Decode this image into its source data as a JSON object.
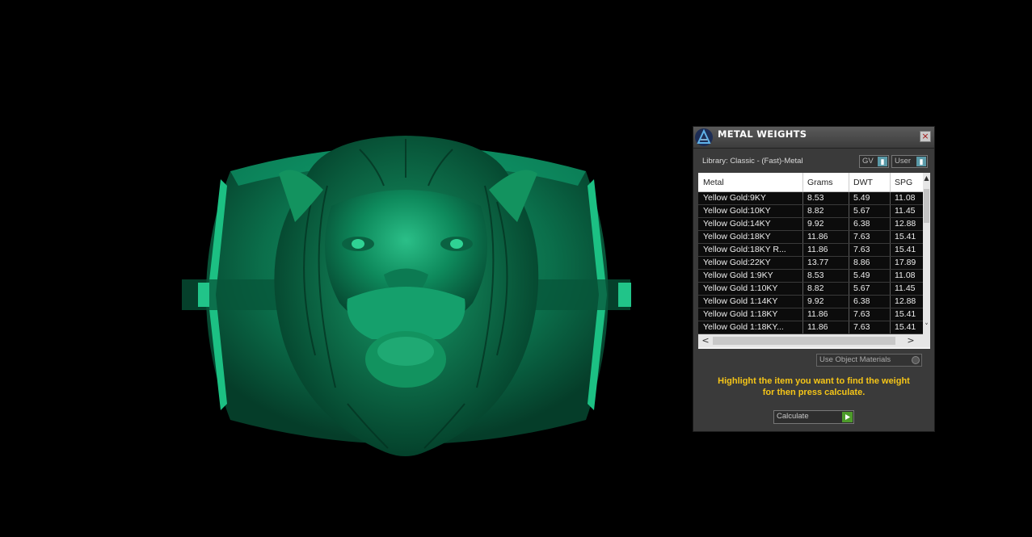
{
  "panel": {
    "title": "METAL WEIGHTS",
    "close_label": "×",
    "library_label": "Library: Classic - (Fast)-Metal",
    "gv_select": "GV",
    "user_select": "User",
    "table": {
      "columns": [
        "Metal",
        "Grams",
        "DWT",
        "SPG"
      ],
      "rows": [
        [
          "Yellow Gold:9KY",
          "8.53",
          "5.49",
          "11.08"
        ],
        [
          "Yellow Gold:10KY",
          "8.82",
          "5.67",
          "11.45"
        ],
        [
          "Yellow Gold:14KY",
          "9.92",
          "6.38",
          "12.88"
        ],
        [
          "Yellow Gold:18KY",
          "11.86",
          "7.63",
          "15.41"
        ],
        [
          "Yellow Gold:18KY R...",
          "11.86",
          "7.63",
          "15.41"
        ],
        [
          "Yellow Gold:22KY",
          "13.77",
          "8.86",
          "17.89"
        ],
        [
          "Yellow Gold 1:9KY",
          "8.53",
          "5.49",
          "11.08"
        ],
        [
          "Yellow Gold 1:10KY",
          "8.82",
          "5.67",
          "11.45"
        ],
        [
          "Yellow Gold 1:14KY",
          "9.92",
          "6.38",
          "12.88"
        ],
        [
          "Yellow Gold 1:18KY",
          "11.86",
          "7.63",
          "15.41"
        ],
        [
          "Yellow Gold 1:18KY...",
          "11.86",
          "7.63",
          "15.41"
        ]
      ]
    },
    "use_object_materials": "Use Object Materials",
    "instruction_line1": "Highlight the item you want to find the weight",
    "instruction_line2": "for then press calculate.",
    "calculate_label": "Calculate",
    "colors": {
      "instruction": "#f5c518",
      "model": "#0e7a55",
      "play_button": "#4d9b2a"
    }
  }
}
